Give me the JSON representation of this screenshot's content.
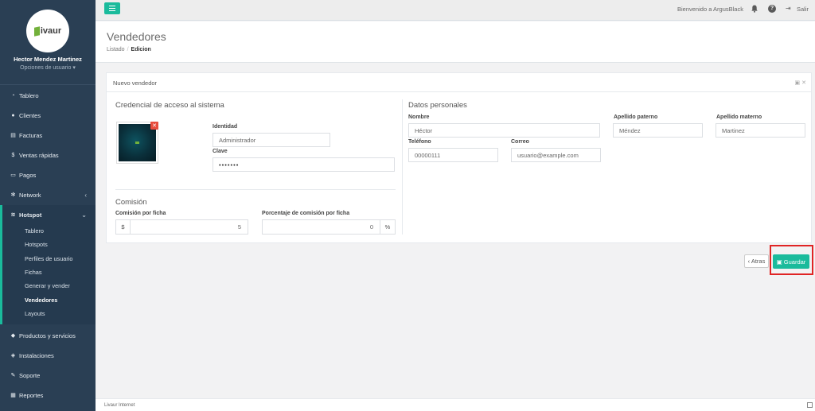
{
  "sidebar": {
    "logo_text": "ivaur",
    "user_name": "Hector Mendez Martinez",
    "user_options": "Opciones de usuario",
    "items": [
      {
        "label": "Tablero",
        "icon": "dashboard-icon"
      },
      {
        "label": "Clientes",
        "icon": "users-icon"
      },
      {
        "label": "Facturas",
        "icon": "invoice-icon"
      },
      {
        "label": "Ventas rápidas",
        "icon": "dollar-icon"
      },
      {
        "label": "Pagos",
        "icon": "payment-icon"
      },
      {
        "label": "Network",
        "icon": "network-icon"
      },
      {
        "label": "Hotspot",
        "icon": "wifi-icon"
      },
      {
        "label": "Productos y servicios",
        "icon": "tag-icon"
      },
      {
        "label": "Instalaciones",
        "icon": "install-icon"
      },
      {
        "label": "Soporte",
        "icon": "wrench-icon"
      },
      {
        "label": "Reportes",
        "icon": "reports-icon"
      }
    ],
    "hotspot_sub": [
      "Tablero",
      "Hotspots",
      "Perfiles de usuario",
      "Fichas",
      "Generar y vender",
      "Vendedores",
      "Layouts"
    ]
  },
  "topbar": {
    "welcome": "Bienvenido a ArgusBlack",
    "signout": "Salir"
  },
  "header": {
    "title": "Vendedores",
    "breadcrumb_list": "Listado",
    "breadcrumb_current": "Edicion"
  },
  "panel": {
    "title": "Nuevo vendedor",
    "credentials": {
      "title": "Credencial de acceso al sistema",
      "identity_label": "Identidad",
      "identity_value": "Administrador",
      "password_label": "Clave",
      "password_value": "•••••••"
    },
    "commission": {
      "title": "Comisión",
      "per_ticket_label": "Comisión por ficha",
      "currency": "$",
      "per_ticket_value": "5",
      "percent_label": "Porcentaje de comisión por ficha",
      "percent_value": "0",
      "percent_symbol": "%"
    },
    "personal": {
      "title": "Datos personales",
      "name_label": "Nombre",
      "name_value": "Héctor",
      "paternal_label": "Apellido paterno",
      "paternal_value": "Méndez",
      "maternal_label": "Apellido materno",
      "maternal_value": "Martinez",
      "phone_label": "Teléfono",
      "phone_value": "00000111",
      "email_label": "Correo",
      "email_value": "usuario@example.com"
    }
  },
  "actions": {
    "back": "‹ Atras",
    "save": "Guardar"
  },
  "footer": {
    "text": "Livaur Internet"
  },
  "colors": {
    "accent": "#1abb9c",
    "sidebar": "#2a3f54",
    "danger": "#e74c3c",
    "highlight": "#e02424"
  }
}
